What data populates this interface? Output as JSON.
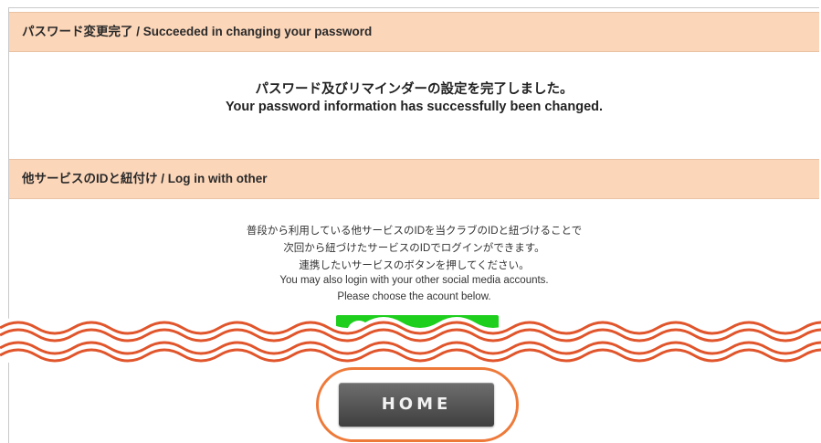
{
  "section1": {
    "title": "パスワード変更完了 / Succeeded in changing your password",
    "message_ja": "パスワード及びリマインダーの設定を完了しました。",
    "message_en": "Your password information has successfully been changed."
  },
  "section2": {
    "title": "他サービスのIDと紐付け / Log in with other",
    "lines": [
      "普段から利用している他サービスのIDを当クラブのIDと紐づけることで",
      "次回から紐づけたサービスのIDでログインができます。",
      "連携したいサービスのボタンを押してください。",
      "You may also login with your other social media accounts.",
      "Please choose the acount below."
    ]
  },
  "home_button": {
    "label": "HOME"
  },
  "colors": {
    "header_bg": "#fcd6b9",
    "social_button": "#1ecf1e",
    "wave": "#e0552b",
    "highlight": "#ee7a3a",
    "home_button": "#4a4a4a"
  },
  "icons": {
    "wave_separator": "wavy-line-break",
    "social_button_icon": "line-logo"
  }
}
